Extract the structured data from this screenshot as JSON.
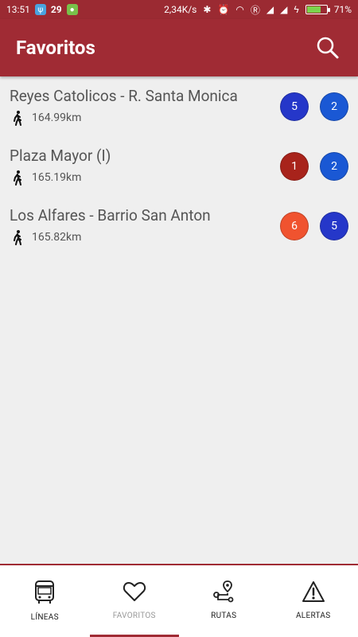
{
  "status_bar": {
    "time": "13:51",
    "notif_temp": "29",
    "network_speed": "2,34K/s",
    "battery_percent": "71%",
    "battery_level": 0.71
  },
  "header": {
    "title": "Favoritos",
    "bg_color": "#a02b34"
  },
  "favorites": [
    {
      "name": "Reyes Catolicos - R. Santa Monica",
      "distance": "164.99km",
      "lines": [
        {
          "label": "5",
          "color": "#2537c9"
        },
        {
          "label": "2",
          "color": "#1a58d4"
        }
      ]
    },
    {
      "name": "Plaza Mayor (I)",
      "distance": "165.19km",
      "lines": [
        {
          "label": "1",
          "color": "#a8231b"
        },
        {
          "label": "2",
          "color": "#1a58d4"
        }
      ]
    },
    {
      "name": "Los Alfares - Barrio San Anton",
      "distance": "165.82km",
      "lines": [
        {
          "label": "6",
          "color": "#f0532f"
        },
        {
          "label": "5",
          "color": "#2537c9"
        }
      ]
    }
  ],
  "bottom_nav": {
    "items": [
      {
        "label": "LÍNEAS",
        "icon": "bus-icon"
      },
      {
        "label": "FAVORITOS",
        "icon": "heart-icon"
      },
      {
        "label": "RUTAS",
        "icon": "route-icon"
      },
      {
        "label": "ALERTAS",
        "icon": "alert-icon"
      }
    ],
    "active_index": 1
  }
}
